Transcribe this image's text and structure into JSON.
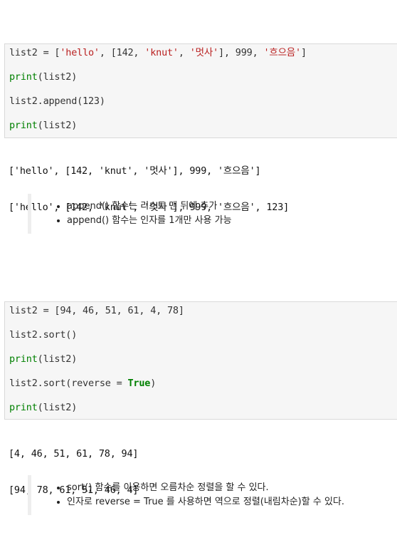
{
  "cell1": {
    "lines": [
      "list2 = ['hello', [142, 'knut', '멋사'], 999, '흐으음']",
      "",
      "print(list2)",
      "",
      "list2.append(123)",
      "",
      "print(list2)"
    ],
    "output": [
      "['hello', [142, 'knut', '멋사'], 999, '흐으음']",
      "['hello', [142, 'knut', '멋사'], 999, '흐으음', 123]"
    ]
  },
  "note1": {
    "items": [
      "append() 함수는 리스트 맨 뒤에 추가",
      "append() 함수는 인자를 1개만 사용 가능"
    ]
  },
  "cell2": {
    "lines": [
      "list2 = [94, 46, 51, 61, 4, 78]",
      "",
      "list2.sort()",
      "",
      "print(list2)",
      "",
      "list2.sort(reverse = True)",
      "",
      "print(list2)"
    ],
    "output": [
      "[4, 46, 51, 61, 78, 94]",
      "[94, 78, 61, 51, 46, 4]"
    ]
  },
  "note2": {
    "items": [
      "sort() 함수를 이용하면 오름차순 정렬을 할 수 있다.",
      "인자로 reverse = True 를 사용하면 역으로 정렬(내림차순)할 수 있다."
    ]
  },
  "colors": {
    "code_bg": "#f6f6f6",
    "builtin": "#008000",
    "string": "#ba2121"
  }
}
